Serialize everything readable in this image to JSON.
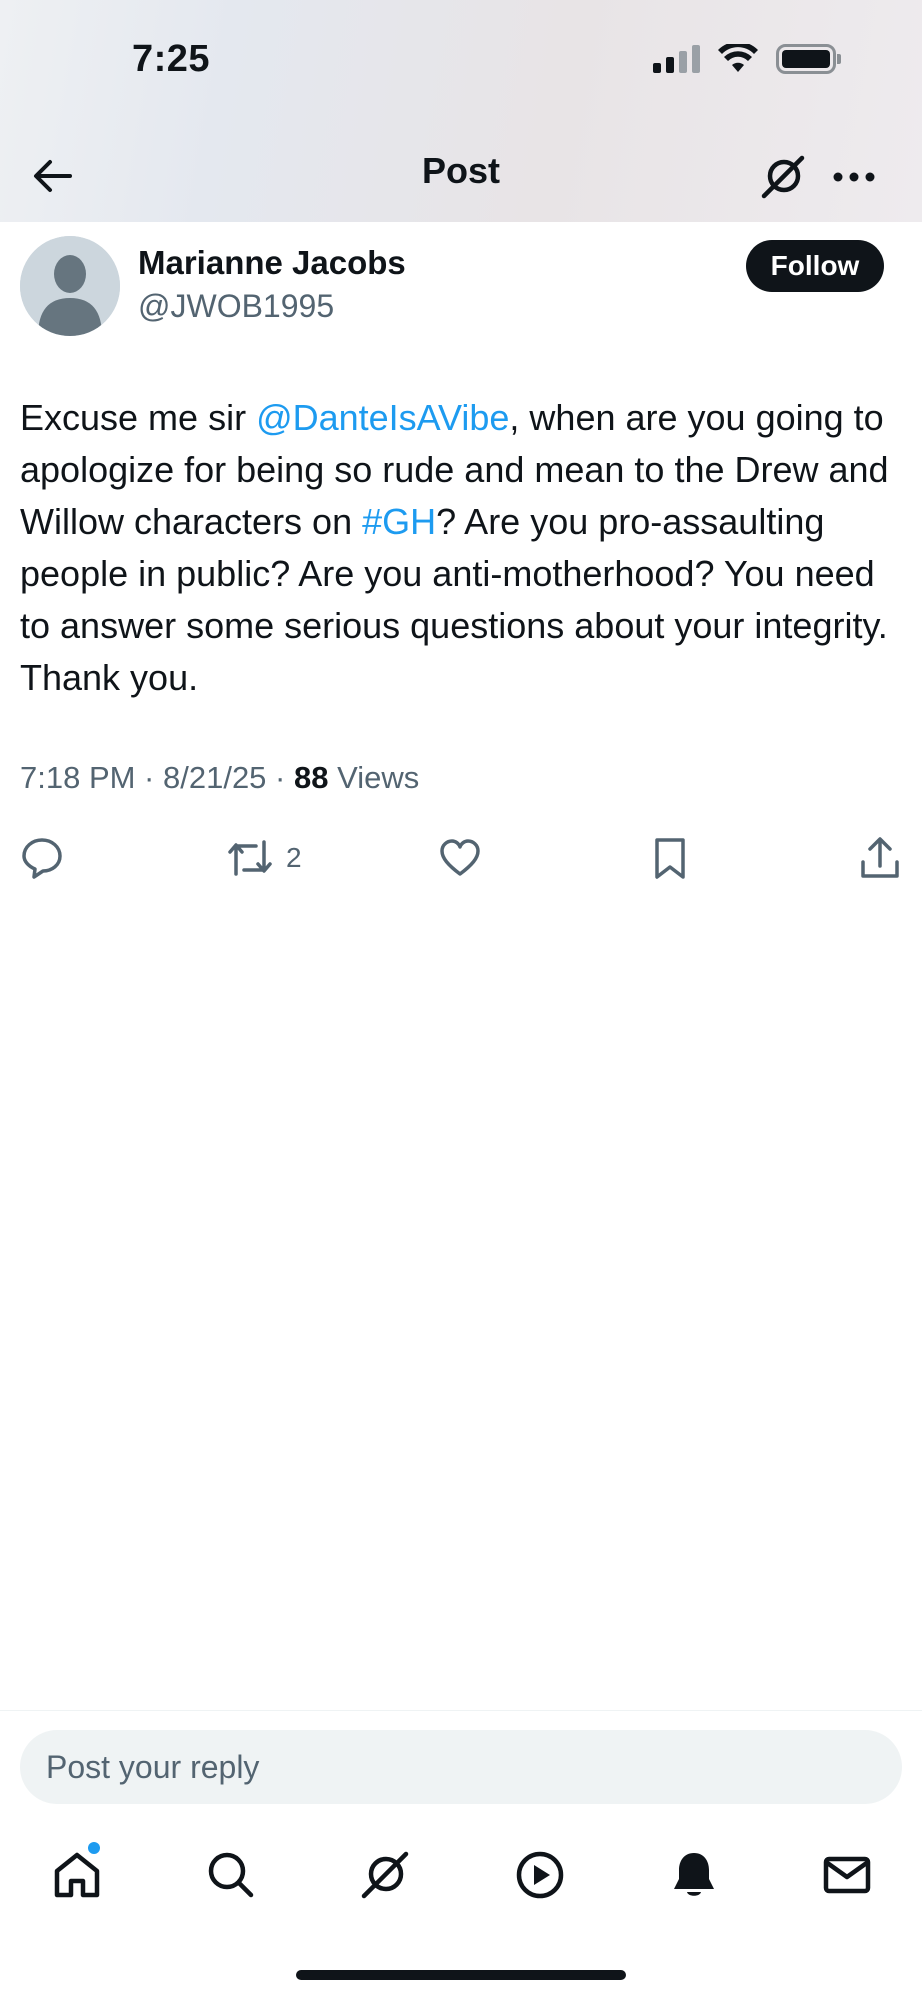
{
  "status_bar": {
    "time": "7:25"
  },
  "header": {
    "title": "Post"
  },
  "post": {
    "author": {
      "name": "Marianne Jacobs",
      "handle": "@JWOB1995"
    },
    "follow_label": "Follow",
    "text_segments": [
      {
        "text": "Excuse me sir ",
        "type": "plain"
      },
      {
        "text": "@DanteIsAVibe",
        "type": "mention"
      },
      {
        "text": ", when are you going to apologize for being so rude and mean to the Drew and Willow characters on ",
        "type": "plain"
      },
      {
        "text": "#GH",
        "type": "hashtag"
      },
      {
        "text": "? Are you pro-assaulting people in public? Are you anti-motherhood? You need to answer some serious questions about your integrity. Thank you.",
        "type": "plain"
      }
    ],
    "timestamp": "7:18 PM · 8/21/25 · ",
    "views_count": "88",
    "views_label": " Views",
    "actions": {
      "reply_count": "",
      "repost_count": "2",
      "like_count": ""
    }
  },
  "reply": {
    "placeholder": "Post your reply"
  },
  "colors": {
    "link": "#1d9bf0",
    "text": "#0f1419",
    "secondary": "#536471",
    "follow_bg": "#0f1419"
  },
  "icons": [
    "back-arrow-icon",
    "grok-icon",
    "more-icon",
    "reply-icon",
    "repost-icon",
    "like-icon",
    "bookmark-icon",
    "share-icon",
    "home-icon",
    "search-icon",
    "grok-icon",
    "video-icon",
    "notifications-icon",
    "messages-icon"
  ]
}
